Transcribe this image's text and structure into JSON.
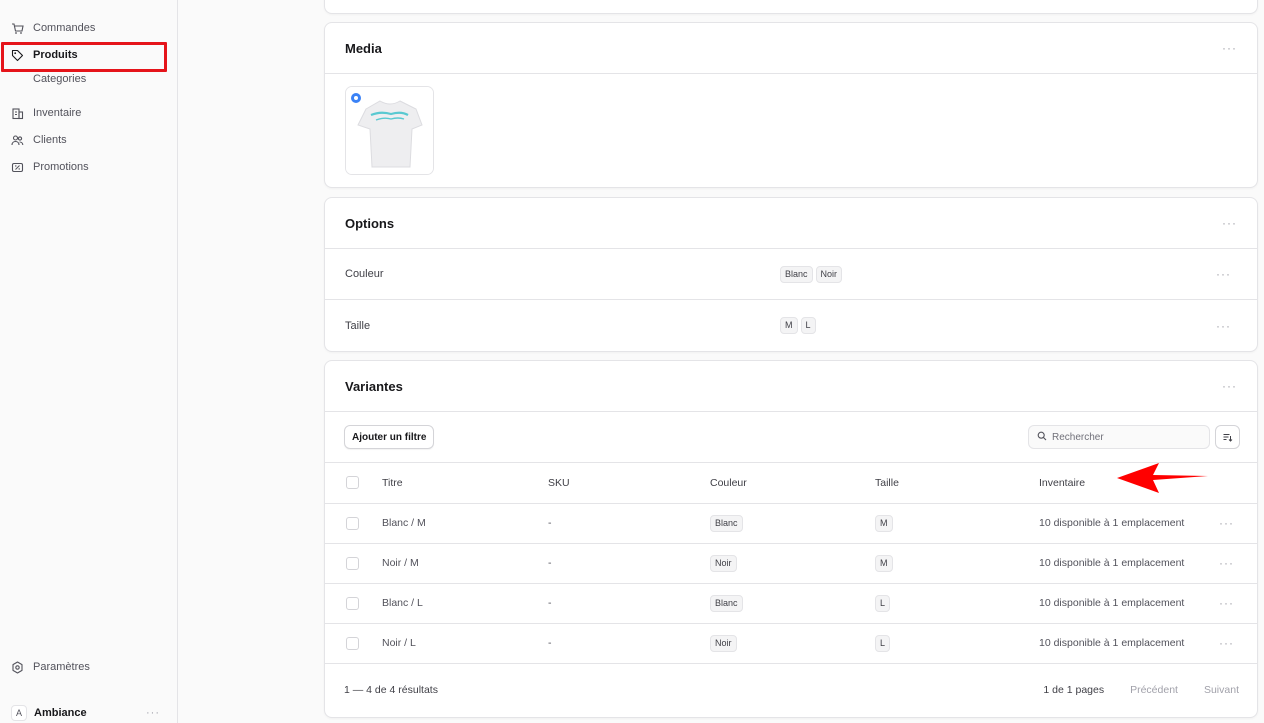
{
  "sidebar": {
    "items": [
      {
        "label": "Commandes",
        "icon": "cart-icon"
      },
      {
        "label": "Produits",
        "icon": "tag-icon"
      },
      {
        "label": "Categories",
        "icon": ""
      },
      {
        "label": "Inventaire",
        "icon": "building-icon"
      },
      {
        "label": "Clients",
        "icon": "users-icon"
      },
      {
        "label": "Promotions",
        "icon": "receipt-percent-icon"
      }
    ],
    "settings_label": "Paramètres",
    "account": {
      "initial": "A",
      "name": "Ambiance",
      "more": "···"
    }
  },
  "media": {
    "title": "Media",
    "more": "···"
  },
  "options": {
    "title": "Options",
    "more": "···",
    "rows": [
      {
        "name": "Couleur",
        "values": [
          "Blanc",
          "Noir"
        ]
      },
      {
        "name": "Taille",
        "values": [
          "M",
          "L"
        ]
      }
    ]
  },
  "variants": {
    "title": "Variantes",
    "more": "···",
    "add_filter_label": "Ajouter un filtre",
    "search_placeholder": "Rechercher",
    "columns": [
      "Titre",
      "SKU",
      "Couleur",
      "Taille",
      "Inventaire"
    ],
    "rows": [
      {
        "title": "Blanc / M",
        "sku": "-",
        "color": "Blanc",
        "size": "M",
        "inventory": "10 disponible à 1 emplacement"
      },
      {
        "title": "Noir / M",
        "sku": "-",
        "color": "Noir",
        "size": "M",
        "inventory": "10 disponible à 1 emplacement"
      },
      {
        "title": "Blanc / L",
        "sku": "-",
        "color": "Blanc",
        "size": "L",
        "inventory": "10 disponible à 1 emplacement"
      },
      {
        "title": "Noir / L",
        "sku": "-",
        "color": "Noir",
        "size": "L",
        "inventory": "10 disponible à 1 emplacement"
      }
    ],
    "footer": {
      "count": "1 — 4 de 4 résultats",
      "pages": "1 de 1 pages",
      "prev": "Précédent",
      "next": "Suivant"
    }
  },
  "colors": {
    "highlight": "#e5141a",
    "arrow": "#ff0000"
  }
}
